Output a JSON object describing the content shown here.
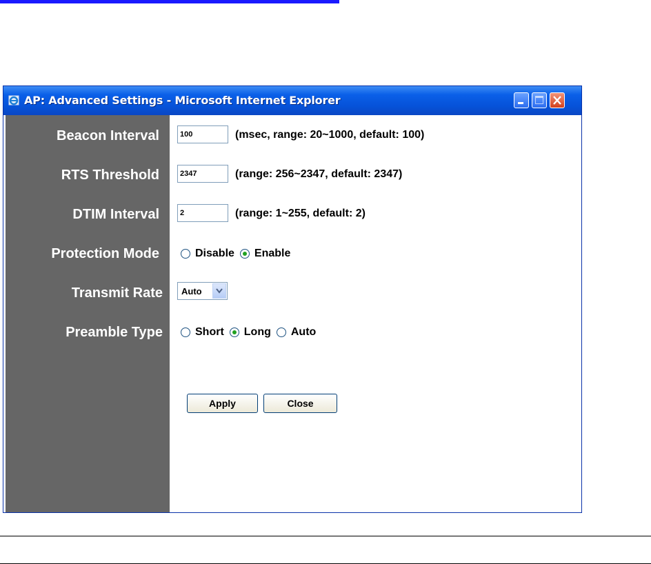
{
  "window": {
    "title": "AP: Advanced Settings - Microsoft Internet Explorer"
  },
  "fields": {
    "beacon_interval": {
      "label": "Beacon Interval",
      "value": "100",
      "hint": "(msec, range: 20~1000, default: 100)"
    },
    "rts_threshold": {
      "label": "RTS Threshold",
      "value": "2347",
      "hint": "(range: 256~2347, default: 2347)"
    },
    "dtim_interval": {
      "label": "DTIM Interval",
      "value": "2",
      "hint": "(range: 1~255, default: 2)"
    },
    "protection_mode": {
      "label": "Protection Mode",
      "options": [
        "Disable",
        "Enable"
      ],
      "selected": "Enable"
    },
    "transmit_rate": {
      "label": "Transmit Rate",
      "value": "Auto"
    },
    "preamble_type": {
      "label": "Preamble Type",
      "options": [
        "Short",
        "Long",
        "Auto"
      ],
      "selected": "Long"
    }
  },
  "buttons": {
    "apply": "Apply",
    "close": "Close"
  },
  "colors": {
    "title_bar": "#0a5fe8",
    "label_pane": "#666666",
    "top_link_underline": "#1a1aff",
    "radio_selected": "#21a121"
  }
}
